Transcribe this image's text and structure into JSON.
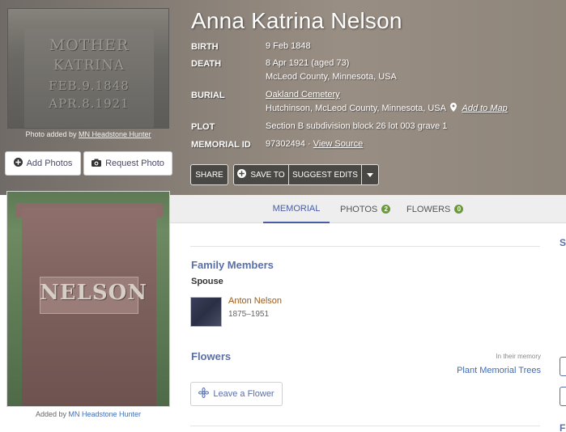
{
  "memorial": {
    "name": "Anna Katrina Nelson",
    "facts": {
      "birth_label": "BIRTH",
      "birth_value": "9 Feb 1848",
      "death_label": "DEATH",
      "death_value": "8 Apr 1921 (aged 73)",
      "death_place": "McLeod County, Minnesota, USA",
      "burial_label": "BURIAL",
      "burial_cemetery": "Oakland Cemetery",
      "burial_place": "Hutchinson, McLeod County, Minnesota, USA",
      "add_to_map": "Add to Map",
      "plot_label": "PLOT",
      "plot_value": "Section B subdivision block 26 lot 003 grave 1",
      "memorial_id_label": "MEMORIAL ID",
      "memorial_id_value": "97302494 ·",
      "view_source": "View Source"
    }
  },
  "actions": {
    "share": "SHARE",
    "save_to": "SAVE TO",
    "suggest_edits": "SUGGEST EDITS"
  },
  "photos": {
    "top_caption_prefix": "Photo added by",
    "top_caption_user": "MN Headstone Hunter",
    "top_engraving": [
      "MOTHER",
      "KATRINA",
      "FEB.9.1848",
      "APR.8.1921"
    ],
    "add_photos": "Add Photos",
    "request_photo": "Request Photo",
    "bottom_engraving": "NELSON",
    "bottom_caption_prefix": "Added by",
    "bottom_caption_user": "MN Headstone Hunter"
  },
  "tabs": [
    {
      "label": "MEMORIAL"
    },
    {
      "label": "PHOTOS",
      "count": "2"
    },
    {
      "label": "FLOWERS",
      "count": "0"
    }
  ],
  "family": {
    "title": "Family Members",
    "spouse_label": "Spouse",
    "spouse_name": "Anton Nelson",
    "spouse_years": "1875–1951"
  },
  "flowers": {
    "title": "Flowers",
    "in_memory": "In their memory",
    "plant_trees": "Plant Memorial Trees",
    "leave_flower": "Leave a Flower"
  },
  "right_edge": {
    "s": "S",
    "f": "F"
  },
  "icons": {
    "add": "plus-circle-icon",
    "camera": "camera-icon",
    "map_pin": "map-pin-icon",
    "flower": "flower-icon",
    "caret": "caret-down-icon"
  }
}
